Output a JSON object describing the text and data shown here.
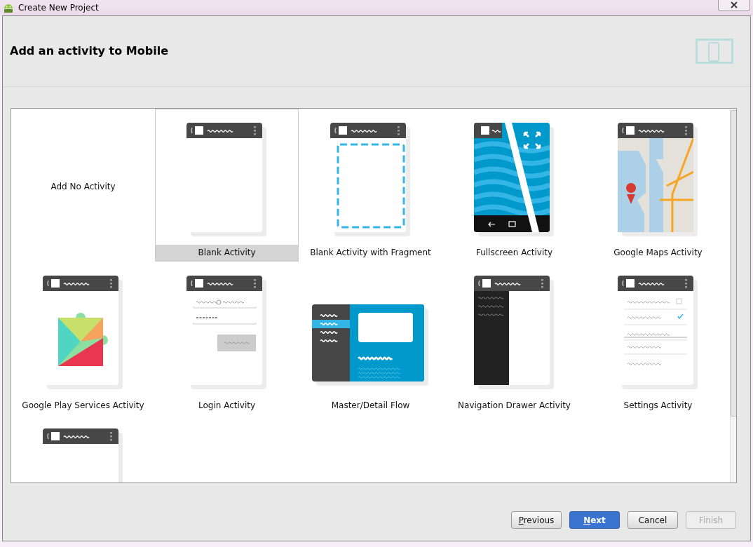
{
  "window": {
    "title": "Create New Project"
  },
  "header": {
    "title": "Add an activity to Mobile"
  },
  "gallery": {
    "items": [
      {
        "kind": "none",
        "label": "Add No Activity",
        "selected": false
      },
      {
        "kind": "blank",
        "label": "Blank Activity",
        "selected": true
      },
      {
        "kind": "fragment",
        "label": "Blank Activity with Fragment",
        "selected": false
      },
      {
        "kind": "fullscreen",
        "label": "Fullscreen Activity",
        "selected": false
      },
      {
        "kind": "maps",
        "label": "Google Maps Activity",
        "selected": false
      },
      {
        "kind": "play",
        "label": "Google Play Services Activity",
        "selected": false
      },
      {
        "kind": "login",
        "label": "Login Activity",
        "selected": false
      },
      {
        "kind": "masterdetail",
        "label": "Master/Detail Flow",
        "selected": false
      },
      {
        "kind": "drawer",
        "label": "Navigation Drawer Activity",
        "selected": false
      },
      {
        "kind": "settings",
        "label": "Settings Activity",
        "selected": false
      },
      {
        "kind": "blank",
        "selected": false
      }
    ]
  },
  "buttons": [
    {
      "label": "Previous",
      "mnemonic_underlined": true,
      "kind": "normal",
      "disabled": false
    },
    {
      "label": "Next",
      "mnemonic_underlined": true,
      "kind": "default",
      "disabled": false
    },
    {
      "label": "Cancel",
      "mnemonic_underlined": false,
      "kind": "normal",
      "disabled": false
    },
    {
      "label": "Finish",
      "mnemonic_underlined": false,
      "kind": "normal",
      "disabled": true
    }
  ]
}
